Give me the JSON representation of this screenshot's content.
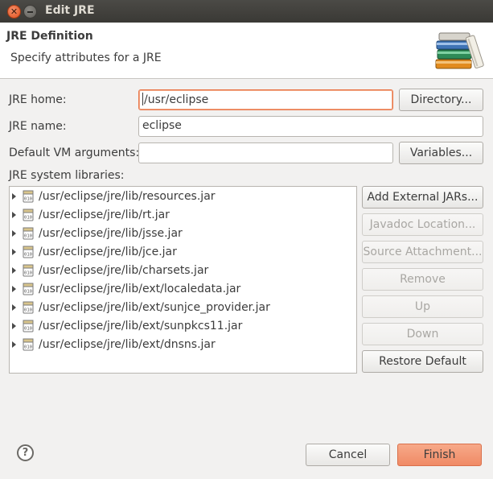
{
  "window": {
    "title": "Edit JRE"
  },
  "header": {
    "title": "JRE Definition",
    "description": "Specify attributes for a JRE",
    "icon": "library-books-icon"
  },
  "form": {
    "jre_home": {
      "label": "JRE home:",
      "value": "/usr/eclipse",
      "button": "Directory..."
    },
    "jre_name": {
      "label": "JRE name:",
      "value": "eclipse"
    },
    "vm_args": {
      "label": "Default VM arguments:",
      "value": "",
      "button": "Variables..."
    }
  },
  "libraries": {
    "label": "JRE system libraries:",
    "items": [
      "/usr/eclipse/jre/lib/resources.jar",
      "/usr/eclipse/jre/lib/rt.jar",
      "/usr/eclipse/jre/lib/jsse.jar",
      "/usr/eclipse/jre/lib/jce.jar",
      "/usr/eclipse/jre/lib/charsets.jar",
      "/usr/eclipse/jre/lib/ext/localedata.jar",
      "/usr/eclipse/jre/lib/ext/sunjce_provider.jar",
      "/usr/eclipse/jre/lib/ext/sunpkcs11.jar",
      "/usr/eclipse/jre/lib/ext/dnsns.jar"
    ],
    "buttons": {
      "add_external": "Add External JARs...",
      "javadoc": "Javadoc Location...",
      "source": "Source Attachment...",
      "remove": "Remove",
      "up": "Up",
      "down": "Down",
      "restore": "Restore Default"
    }
  },
  "footer": {
    "cancel": "Cancel",
    "finish": "Finish",
    "help_glyph": "?"
  },
  "colors": {
    "accent": "#f08a65",
    "focus_border": "#e9774a",
    "titlebar": "#3c3b37"
  }
}
